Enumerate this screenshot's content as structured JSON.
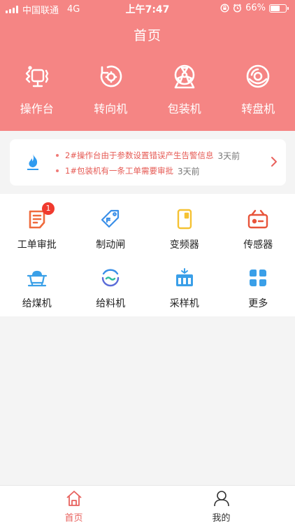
{
  "status_bar": {
    "carrier": "中国联通",
    "network": "4G",
    "time": "上午7:47",
    "battery": "66%",
    "battery_level": 0.66
  },
  "header": {
    "title": "首页"
  },
  "top_nav": [
    {
      "label": "操作台",
      "icon": "console-icon"
    },
    {
      "label": "转向机",
      "icon": "rotate-icon"
    },
    {
      "label": "包装机",
      "icon": "packaging-icon"
    },
    {
      "label": "转盘机",
      "icon": "turntable-icon"
    }
  ],
  "notices": [
    {
      "text": "2#操作台由于参数设置错误产生告警信息",
      "time": "3天前"
    },
    {
      "text": "1#包装机有一条工单需要审批",
      "time": "3天前"
    }
  ],
  "grid": [
    {
      "label": "工单审批",
      "icon": "document-icon",
      "badge": "1"
    },
    {
      "label": "制动闸",
      "icon": "tag-icon"
    },
    {
      "label": "变频器",
      "icon": "inverter-icon"
    },
    {
      "label": "传感器",
      "icon": "radio-icon"
    },
    {
      "label": "给煤机",
      "icon": "coal-cart-icon"
    },
    {
      "label": "给料机",
      "icon": "feeder-icon"
    },
    {
      "label": "采样机",
      "icon": "sampler-icon"
    },
    {
      "label": "更多",
      "icon": "more-icon"
    }
  ],
  "tabbar": {
    "home": "首页",
    "mine": "我的"
  },
  "colors": {
    "primary": "#f58584",
    "accent_text": "#e65b55",
    "badge": "#f03a2e"
  }
}
